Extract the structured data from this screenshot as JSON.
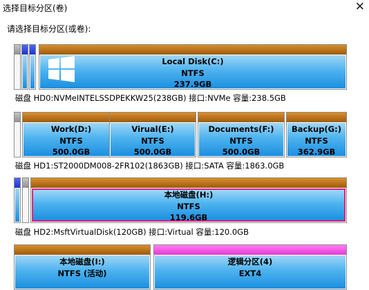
{
  "window": {
    "title": "选择目标分区(卷)",
    "prompt": "请选择目标分区(或卷):"
  },
  "disks": [
    {
      "caption": "磁盘 HD0:NVMeINTELSSDPEKKW25(238GB)  接口:NVMe  容量:238.5GB",
      "partitions": [
        {
          "name": "Local Disk(C:)",
          "fs": "NTFS",
          "size": "237.9GB"
        }
      ]
    },
    {
      "caption": "磁盘 HD1:ST2000DM008-2FR102(1863GB)  接口:SATA  容量:1863.0GB",
      "partitions": [
        {
          "name": "Work(D:)",
          "fs": "NTFS",
          "size": "500.0GB"
        },
        {
          "name": "Virual(E:)",
          "fs": "NTFS",
          "size": "500.0GB"
        },
        {
          "name": "Documents(F:)",
          "fs": "NTFS",
          "size": "500.0GB"
        },
        {
          "name": "Backup(G:)",
          "fs": "NTFS",
          "size": "362.9GB"
        }
      ]
    },
    {
      "caption": "磁盘 HD2:MsftVirtualDisk(120GB)  接口:Virtual  容量:120.0GB",
      "partitions": [
        {
          "name": "本地磁盘(H:)",
          "fs": "NTFS",
          "size": "119.6GB"
        }
      ]
    },
    {
      "caption": "",
      "partitions": [
        {
          "name": "本地磁盘(I:)",
          "fs": "NTFS (活动)",
          "size": ""
        },
        {
          "name": "逻辑分区(4)",
          "fs": "EXT4",
          "size": ""
        }
      ]
    }
  ],
  "icons": {
    "close": "close-icon",
    "windows": "windows-logo-icon"
  },
  "colors": {
    "partition_top": "#c07820",
    "partition_fill": "#4eb3ef",
    "selected_border": "#e0207a",
    "small_blue": "#2b3ddb",
    "pink_top": "#f060e0"
  }
}
